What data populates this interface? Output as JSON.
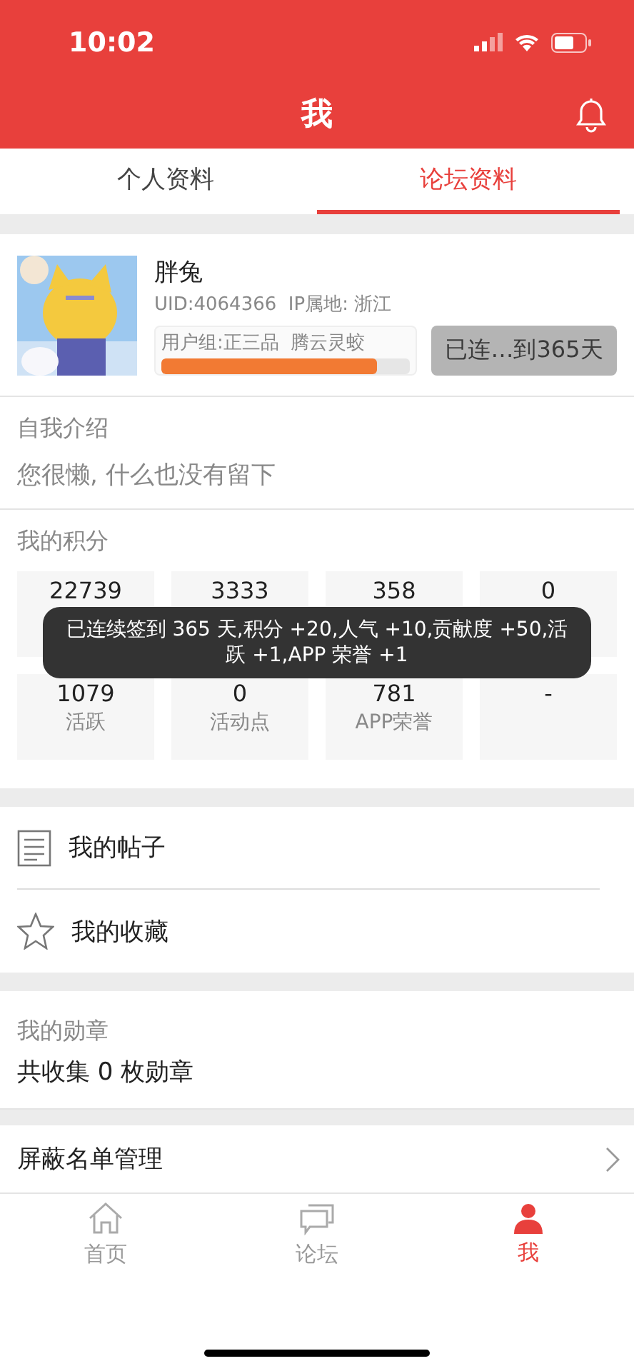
{
  "status_bar": {
    "time": "10:02"
  },
  "header": {
    "title": "我"
  },
  "tabs": [
    {
      "label": "个人资料",
      "selected": false
    },
    {
      "label": "论坛资料",
      "selected": true
    }
  ],
  "profile": {
    "name": "胖兔",
    "uid": "UID:4064366",
    "ip": "IP属地: 浙江",
    "group": "用户组:正三品  腾云灵蛟",
    "level": 0.87,
    "signin": {
      "label": "已连…到365天",
      "disabled": true
    }
  },
  "intro": {
    "title": "自我介绍",
    "text": "您很懒, 什么也没有留下"
  },
  "points": {
    "title": "我的积分",
    "items": [
      {
        "value": "22739"
      },
      {
        "value": "3333"
      },
      {
        "value": "358"
      },
      {
        "value": "0"
      },
      {
        "value": "1079",
        "label": "活跃"
      },
      {
        "value": "0",
        "label": "活动点"
      },
      {
        "value": "781",
        "label": "APP荣誉"
      },
      {
        "value": "-"
      }
    ]
  },
  "toast": "已连续签到 365 天,积分 +20,人气 +10,贡献度 +50,活跃 +1,APP 荣誉 +1",
  "links": [
    {
      "kind": "posts",
      "label": "我的帖子"
    },
    {
      "kind": "favorites",
      "label": "我的收藏"
    }
  ],
  "medals": {
    "title": "我的勋章",
    "text": "共收集 0 枚勋章"
  },
  "block_list": {
    "label": "屏蔽名单管理"
  },
  "bottom_nav": [
    {
      "kind": "home",
      "label": "首页",
      "selected": false
    },
    {
      "kind": "forum",
      "label": "论坛",
      "selected": false
    },
    {
      "kind": "me",
      "label": "我",
      "selected": true
    }
  ]
}
